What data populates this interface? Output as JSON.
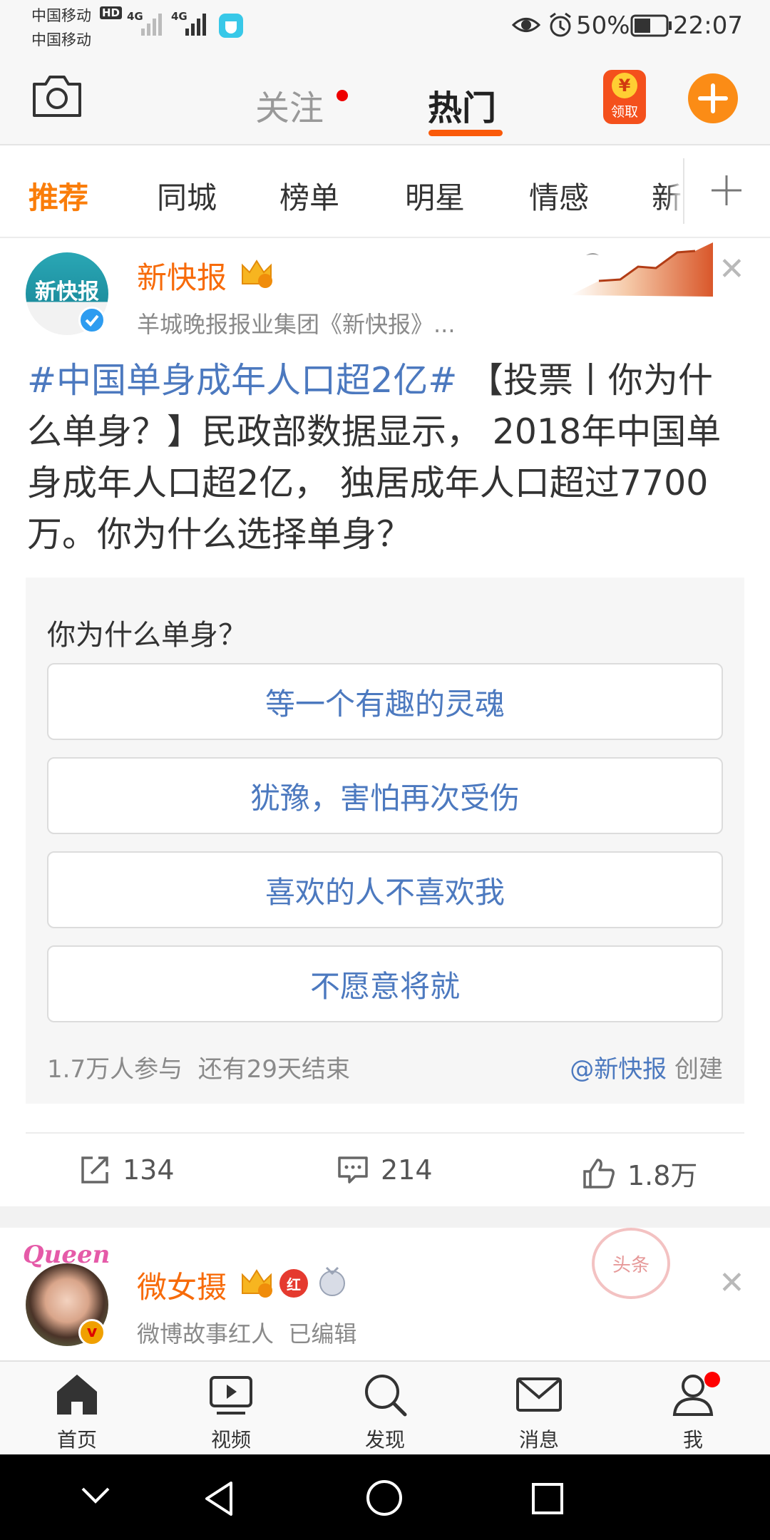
{
  "status_bar": {
    "carrier_1": "中国移动",
    "carrier_2": "中国移动",
    "hd_label": "HD",
    "network_1": "4G",
    "network_2": "4G",
    "battery_percent": "50%",
    "time": "22:07"
  },
  "top_nav": {
    "tabs": [
      {
        "label": "关注"
      },
      {
        "label": "热门"
      }
    ],
    "coupon_label": "领取",
    "coupon_symbol": "¥"
  },
  "categories": {
    "items": [
      {
        "label": "推荐"
      },
      {
        "label": "同城"
      },
      {
        "label": "榜单"
      },
      {
        "label": "明星"
      },
      {
        "label": "情感"
      },
      {
        "label": "新"
      }
    ]
  },
  "post": {
    "author": "新快报",
    "avatar_text": "新快报",
    "subtitle": "羊城晚报报业集团《新快报》...",
    "hashtag": "#中国单身成年人口超2亿#",
    "body": " 【投票丨你为什么单身？】民政部数据显示， 2018年中国单身成年人口超2亿， 独居成年人口超过7700万。你为什么选择单身？",
    "poll": {
      "question": "你为什么单身？",
      "options": [
        "等一个有趣的灵魂",
        "犹豫，害怕再次受伤",
        "喜欢的人不喜欢我",
        "不愿意将就"
      ],
      "participants": "1.7万人参与",
      "remaining": "还有29天结束",
      "creator_at": "@新快报",
      "creator_suffix": " 创建"
    },
    "actions": {
      "repost_count": "134",
      "comment_count": "214",
      "like_count": "1.8万"
    }
  },
  "post2": {
    "author": "微女摄",
    "subtitle": "微博故事红人",
    "edited": "已编辑",
    "avatar_text": "Queen",
    "badge_red": "红",
    "stamp_text": "头条"
  },
  "tab_bar": {
    "items": [
      {
        "label": "首页"
      },
      {
        "label": "视频"
      },
      {
        "label": "发现"
      },
      {
        "label": "消息"
      },
      {
        "label": "我"
      }
    ]
  },
  "colors": {
    "brand_orange": "#fa7d0a",
    "link_blue": "#4c79bf",
    "verified_blue": "#2d9cf0"
  }
}
